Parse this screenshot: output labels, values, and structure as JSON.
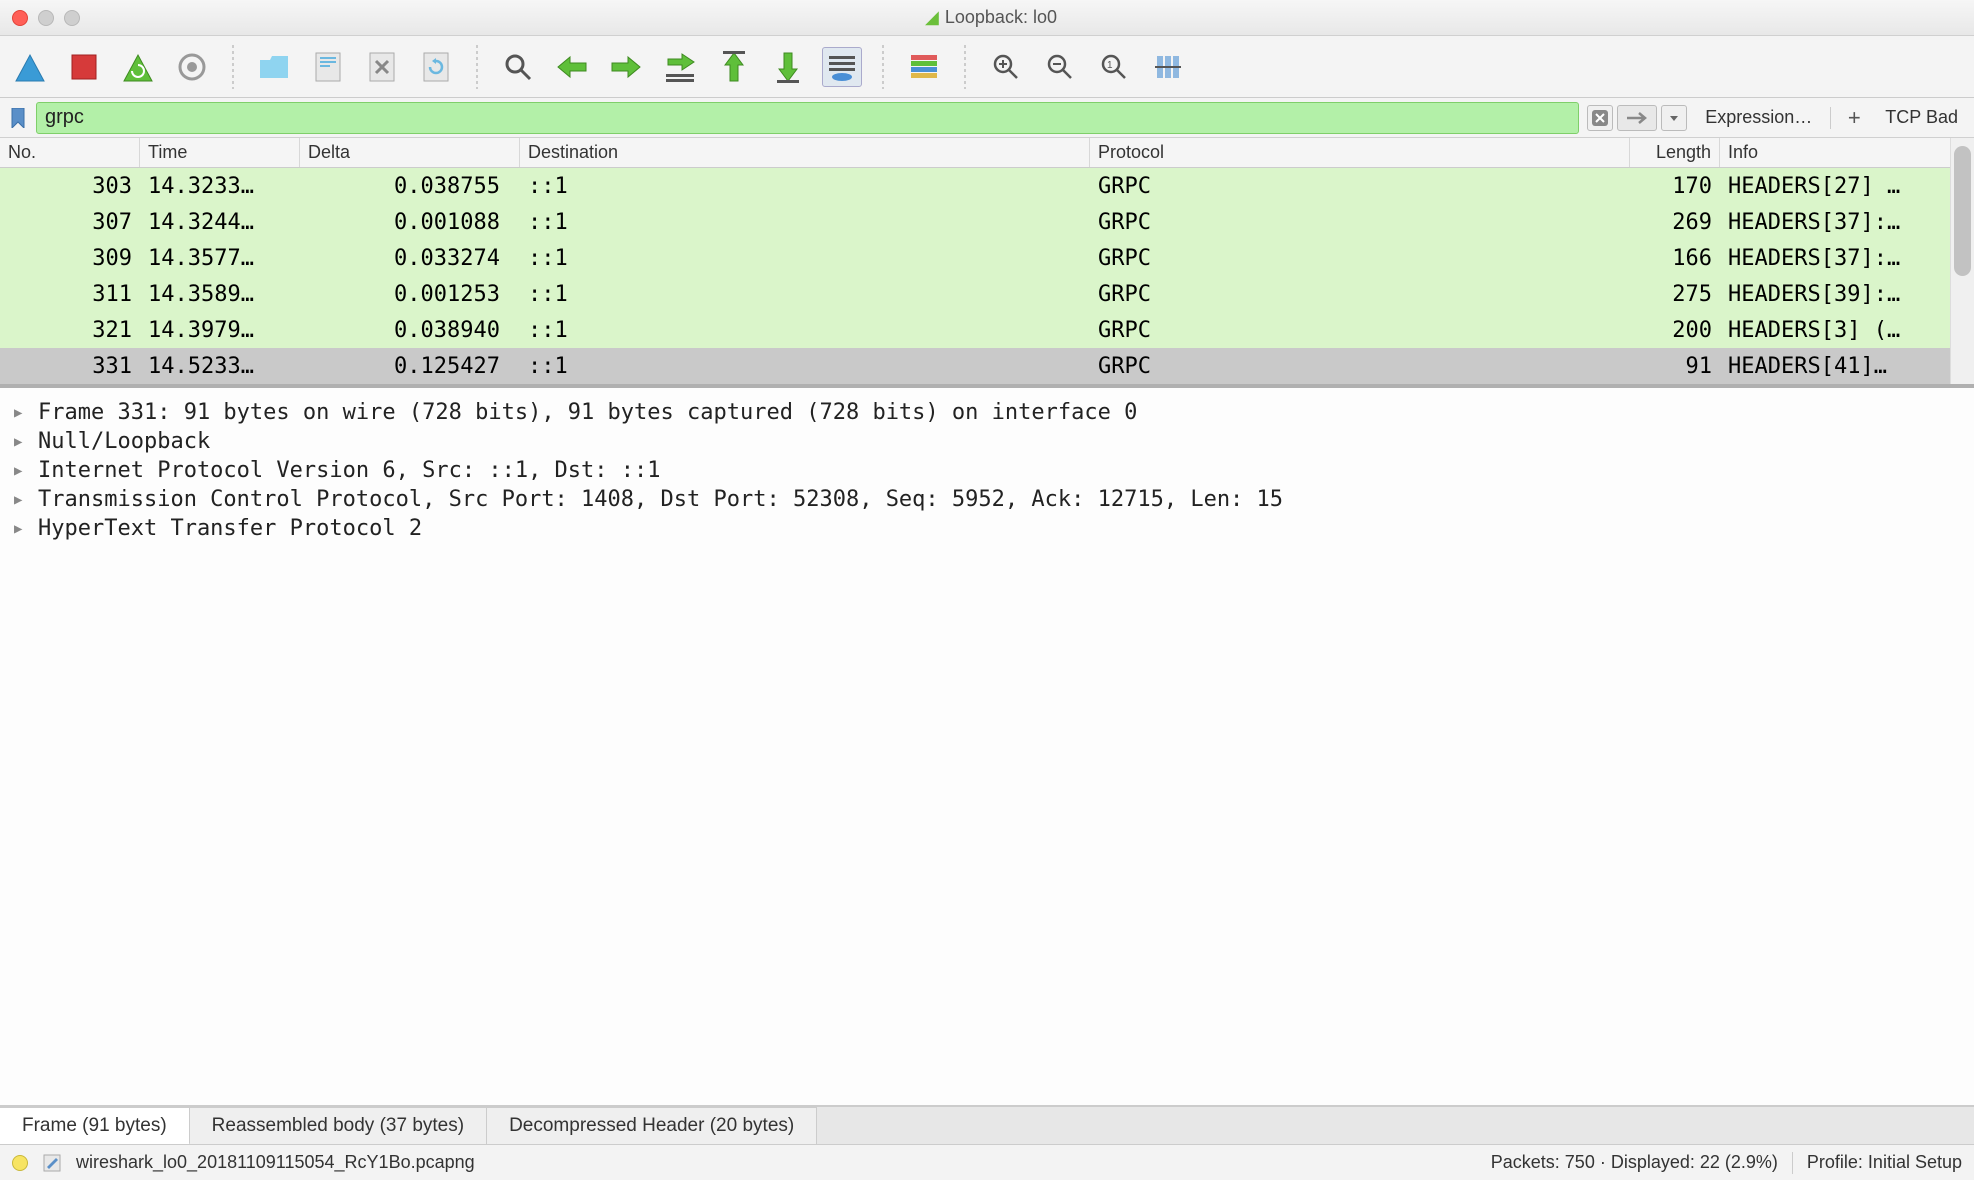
{
  "window": {
    "title": "Loopback: lo0"
  },
  "filter": {
    "value": "grpc",
    "expression_label": "Expression…",
    "tcp_bad_label": "TCP Bad"
  },
  "columns": {
    "no": "No.",
    "time": "Time",
    "delta": "Delta",
    "destination": "Destination",
    "protocol": "Protocol",
    "length": "Length",
    "info": "Info"
  },
  "packets": [
    {
      "no": "303",
      "time": "14.3233…",
      "delta": "0.038755",
      "dest": "::1",
      "proto": "GRPC",
      "len": "170",
      "info": "HEADERS[27] …",
      "sel": false
    },
    {
      "no": "307",
      "time": "14.3244…",
      "delta": "0.001088",
      "dest": "::1",
      "proto": "GRPC",
      "len": "269",
      "info": "HEADERS[37]:…",
      "sel": false
    },
    {
      "no": "309",
      "time": "14.3577…",
      "delta": "0.033274",
      "dest": "::1",
      "proto": "GRPC",
      "len": "166",
      "info": "HEADERS[37]:…",
      "sel": false
    },
    {
      "no": "311",
      "time": "14.3589…",
      "delta": "0.001253",
      "dest": "::1",
      "proto": "GRPC",
      "len": "275",
      "info": "HEADERS[39]:…",
      "sel": false
    },
    {
      "no": "321",
      "time": "14.3979…",
      "delta": "0.038940",
      "dest": "::1",
      "proto": "GRPC",
      "len": "200",
      "info": "HEADERS[3] (…",
      "sel": false
    },
    {
      "no": "331",
      "time": "14.5233…",
      "delta": "0.125427",
      "dest": "::1",
      "proto": "GRPC",
      "len": "91",
      "info": "HEADERS[41]…",
      "sel": true
    }
  ],
  "details": [
    "Frame 331: 91 bytes on wire (728 bits), 91 bytes captured (728 bits) on interface 0",
    "Null/Loopback",
    "Internet Protocol Version 6, Src: ::1, Dst: ::1",
    "Transmission Control Protocol, Src Port: 1408, Dst Port: 52308, Seq: 5952, Ack: 12715, Len: 15",
    "HyperText Transfer Protocol 2"
  ],
  "bottom_tabs": [
    {
      "label": "Frame (91 bytes)",
      "active": true
    },
    {
      "label": "Reassembled body (37 bytes)",
      "active": false
    },
    {
      "label": "Decompressed Header (20 bytes)",
      "active": false
    }
  ],
  "status": {
    "filename": "wireshark_lo0_20181109115054_RcY1Bo.pcapng",
    "packets": "Packets: 750 · Displayed: 22 (2.9%)",
    "profile": "Profile: Initial Setup"
  },
  "icons": {
    "search": "search",
    "back": "back",
    "fwd": "fwd",
    "jump": "jump",
    "top": "top",
    "bottom": "bottom",
    "autoscroll": "autoscroll",
    "colorize": "colorize",
    "zoomin": "zoomin",
    "zoomout": "zoomout",
    "zoomreset": "zoomreset",
    "resize": "resize"
  }
}
